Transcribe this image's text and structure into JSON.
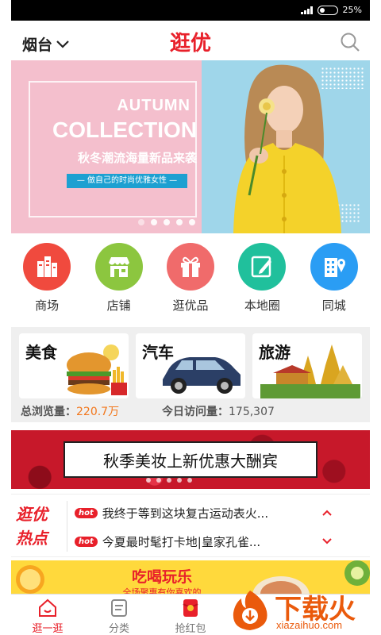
{
  "status_bar": {
    "battery": "25%"
  },
  "header": {
    "city": "烟台",
    "title": "逛优"
  },
  "banner": {
    "line1": "AUTUMN",
    "line2": "COLLECTION",
    "subtitle": "秋冬潮流海量新品来袭",
    "tagline": "— 做自己的时尚优雅女性 —"
  },
  "categories": [
    {
      "label": "商场",
      "icon": "mall-icon",
      "color": "#f04a3e"
    },
    {
      "label": "店铺",
      "icon": "store-icon",
      "color": "#8cc63f"
    },
    {
      "label": "逛优品",
      "icon": "gift-icon",
      "color": "#f06b6b"
    },
    {
      "label": "本地圈",
      "icon": "notebook-icon",
      "color": "#20c09c"
    },
    {
      "label": "同城",
      "icon": "city-building-icon",
      "color": "#2a9df4"
    }
  ],
  "cards": [
    {
      "title": "美食"
    },
    {
      "title": "汽车"
    },
    {
      "title": "旅游"
    }
  ],
  "stats": {
    "total_label": "总浏览量：",
    "total_value": "220.7万",
    "today_label": "今日访问量：",
    "today_value": "175,307"
  },
  "promo": {
    "text": "秋季美妆上新优惠大酬宾"
  },
  "hot_news": {
    "badge_line1": "逛优",
    "badge_line2": "热点",
    "tag": "hot",
    "items": [
      "我终于等到这块复古运动表火...",
      "今夏最时髦打卡地|皇家孔雀..."
    ]
  },
  "food_promo": {
    "title": "吃喝玩乐",
    "subtitle": "全场聚惠有你喜欢的"
  },
  "tabs": [
    {
      "label": "逛一逛",
      "active": true
    },
    {
      "label": "分类",
      "active": false
    },
    {
      "label": "抢红包",
      "active": false
    }
  ],
  "watermark": {
    "text": "下载火",
    "url": "xiazaihuo.com"
  }
}
